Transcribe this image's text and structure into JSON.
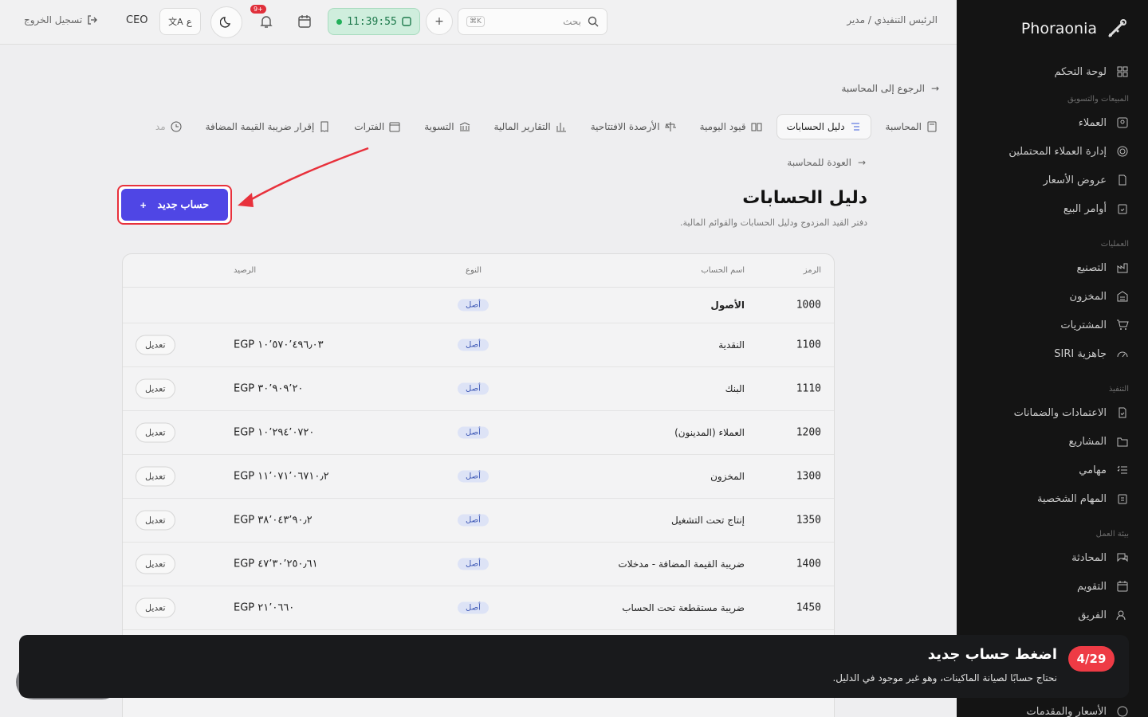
{
  "brand": {
    "name": "Phoraonia"
  },
  "sidebar": {
    "dashboard": "لوحة التحكم",
    "groups": [
      {
        "label": "المبيعات والتسويق",
        "items": [
          "العملاء",
          "إدارة العملاء المحتملين",
          "عروض الأسعار",
          "أوامر البيع"
        ]
      },
      {
        "label": "العمليات",
        "items": [
          "التصنيع",
          "المخزون",
          "المشتريات",
          "جاهزية SIRI"
        ]
      },
      {
        "label": "التنفيذ",
        "items": [
          "الاعتمادات والضمانات",
          "المشاريع",
          "مهامي",
          "المهام الشخصية"
        ]
      },
      {
        "label": "بيئة العمل",
        "items": [
          "المحادثة",
          "التقويم",
          "الفريق"
        ]
      }
    ],
    "bottom_item": "الأسعار والمقدمات"
  },
  "topbar": {
    "breadcrumb": "الرئيس التنفيذي / مدير",
    "search_placeholder": "بحث",
    "search_kbd": "K⌘",
    "time": "11:39:55",
    "notifications_badge": "+9",
    "role": "CEO",
    "lang_label": "ع",
    "logout": "تسجيل الخروج"
  },
  "main": {
    "back_top": "الرجوع إلى المحاسبة",
    "tabs": [
      "المحاسبة",
      "دليل الحسابات",
      "قيود اليومية",
      "الأرصدة الافتتاحية",
      "التقارير المالية",
      "التسوية",
      "الفترات",
      "إقرار ضريبة القيمة المضافة",
      "مد"
    ],
    "back_accounting": "العودة للمحاسبة",
    "title": "دليل الحسابات",
    "subtitle": "دفتر القيد المزدوج ودليل الحسابات والقوائم المالية.",
    "new_account_label": "حساب جديد"
  },
  "table": {
    "headers": {
      "code": "الرمز",
      "name": "اسم الحساب",
      "type": "النوع",
      "balance": "الرصيد"
    },
    "edit_label": "تعديل",
    "rows": [
      {
        "code": "1000",
        "name": "الأصول",
        "type": "أصل",
        "balance": ""
      },
      {
        "code": "1100",
        "name": "النقدية",
        "type": "أصل",
        "balance": "EGP ١٠٬٥٧٠٬٤٩٦٫٠٣"
      },
      {
        "code": "1110",
        "name": "البنك",
        "type": "أصل",
        "balance": "EGP ٣٠٬٩٠٩٬٢٠"
      },
      {
        "code": "1200",
        "name": "العملاء (المدينون)",
        "type": "أصل",
        "balance": "EGP ١٠٬٢٩٤٬٠٧٢٠"
      },
      {
        "code": "1300",
        "name": "المخزون",
        "type": "أصل",
        "balance": "EGP ١١٬٠٧١٬٠٦٧١٠٫٢"
      },
      {
        "code": "1350",
        "name": "إنتاج تحت التشغيل",
        "type": "أصل",
        "balance": "EGP ٣٨٬٠٤٣٬٩٠٫٢"
      },
      {
        "code": "1400",
        "name": "ضريبة القيمة المضافة - مدخلات",
        "type": "أصل",
        "balance": "EGP ٤٧٬٣٠٬٢٥٠٫٦١"
      },
      {
        "code": "1450",
        "name": "ضريبة مستقطعة تحت الحساب",
        "type": "أصل",
        "balance": "EGP ٢١٬٠٦٦٠"
      }
    ]
  },
  "tour": {
    "step": "4/29",
    "title": "اضغط حساب جديد",
    "text": "نحتاج حسابًا لصيانة الماكينات، وهو غير موجود في الدليل."
  }
}
